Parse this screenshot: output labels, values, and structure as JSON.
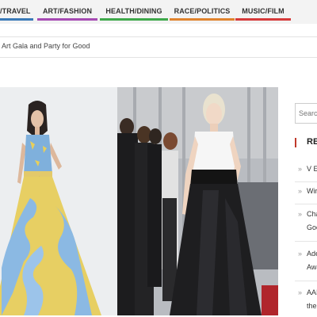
{
  "nav": {
    "items": [
      {
        "label": "/TRAVEL",
        "underline_color": "#3a7ab8"
      },
      {
        "label": "ART/FASHION",
        "underline_color": "#a64ab3"
      },
      {
        "label": "HEALTH/DINING",
        "underline_color": "#3ea84a"
      },
      {
        "label": "RACE/POLITICS",
        "underline_color": "#e0832d"
      },
      {
        "label": "MUSIC/FILM",
        "underline_color": "#d63a3a"
      }
    ]
  },
  "breadcrumb": {
    "current": "Art Gala and Party for Good"
  },
  "sidebar": {
    "search_placeholder": "Searc",
    "section_title": "RE",
    "recent_items": [
      {
        "line1": "V E",
        "line2": ""
      },
      {
        "line1": "Wir",
        "line2": ""
      },
      {
        "line1": "Cha",
        "line2": "Goo"
      },
      {
        "line1": "Ade",
        "line2": "Awa"
      },
      {
        "line1": "AAI",
        "line2": "the"
      }
    ]
  },
  "colors": {
    "accent": "#c0392b"
  }
}
